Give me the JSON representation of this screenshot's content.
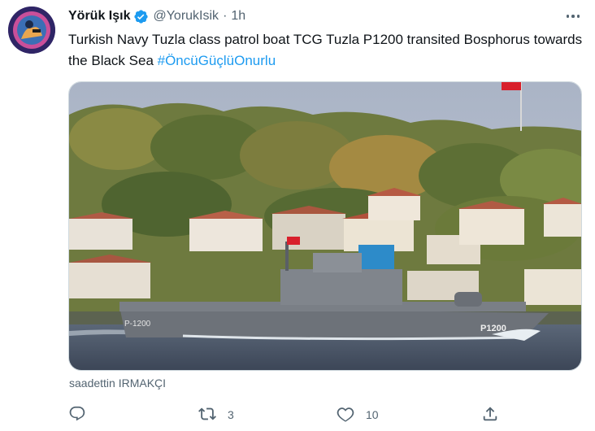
{
  "author": {
    "name": "Yörük Işık",
    "handle": "@YorukIsik",
    "separator": "·",
    "time": "1h"
  },
  "tweet": {
    "text": "Turkish Navy Tuzla class patrol boat TCG Tuzla P1200 transited Bosphorus towards the Black Sea ",
    "hashtag": "#ÖncüGüçlüOnurlu"
  },
  "media": {
    "credit": "saadettin IRMAKÇI",
    "hull_number": "P1200",
    "bow_number": "P-1200"
  },
  "actions": {
    "reply_count": "",
    "retweet_count": "3",
    "like_count": "10"
  },
  "icons": {
    "verified": "verified-badge-icon",
    "more": "more-options-icon",
    "reply": "reply-icon",
    "retweet": "retweet-icon",
    "like": "heart-icon",
    "share": "share-icon"
  },
  "colors": {
    "accent": "#1d9bf0",
    "secondary_text": "#536471",
    "primary_text": "#0f1419"
  }
}
